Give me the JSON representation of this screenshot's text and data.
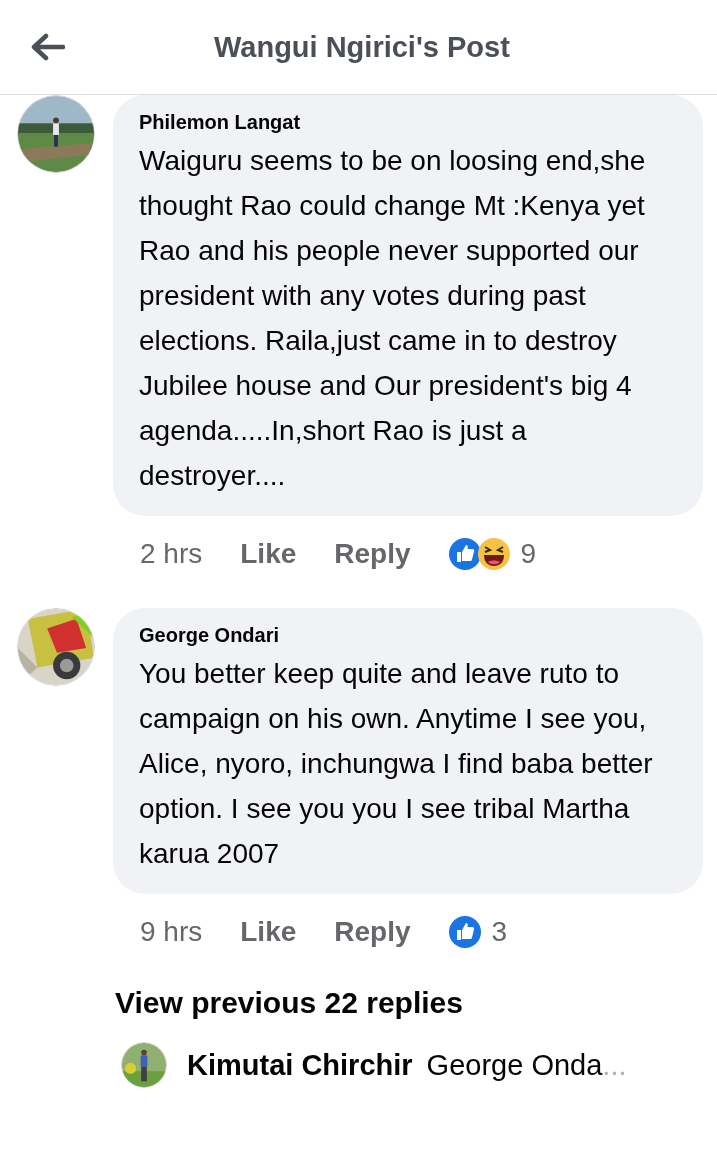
{
  "header": {
    "title": "Wangui Ngirici's Post"
  },
  "comments": [
    {
      "author": "Philemon Langat",
      "avatar": {
        "kind": "picture"
      },
      "text": "Waiguru seems to be on loosing end,she thought Rao could change Mt :Kenya yet Rao and his people never supported our president with any votes during past elections. Raila,just came in to destroy Jubilee house and Our president's big 4 agenda.....In,short Rao is just a destroyer....",
      "time": "2 hrs",
      "like": "Like",
      "reply": "Reply",
      "reactions": [
        {
          "kind": "like"
        },
        {
          "kind": "haha"
        }
      ],
      "count": "9"
    },
    {
      "author": "George Ondari",
      "avatar": {
        "kind": "picture"
      },
      "text": "You better keep quite and leave ruto to campaign on his own. Anytime I see you, Alice, nyoro, inchungwa I find baba better option. I see you you I see tribal Martha karua 2007",
      "time": "9 hrs",
      "like": "Like",
      "reply": "Reply",
      "reactions": [
        {
          "kind": "like"
        }
      ],
      "count": "3"
    }
  ],
  "view_previous": "View previous 22 replies",
  "reply_preview": {
    "author": "Kimutai Chirchir",
    "snippet": "George Onda",
    "ellipsis": "..."
  }
}
